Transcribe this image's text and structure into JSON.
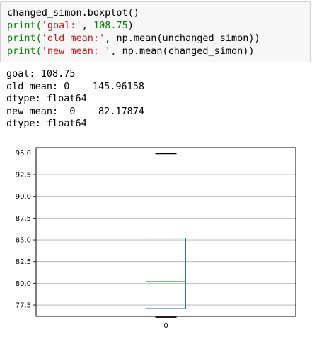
{
  "code_cell": {
    "line1": "changed_simon.boxplot()",
    "line2": {
      "fn": "print(",
      "s1": "'goal:'",
      "sep": ", ",
      "num": "108.75",
      "close": ")"
    },
    "line3": {
      "fn": "print(",
      "s1": "'old mean:'",
      "rest": ", np.mean(unchanged_simon))"
    },
    "line4": {
      "fn": "print(",
      "s1": "'new mean: '",
      "rest": ", np.mean(changed_simon))"
    }
  },
  "output": {
    "lines": [
      "goal: 108.75",
      "old mean: 0    145.96158",
      "dtype: float64",
      "new mean:  0    82.17874",
      "dtype: float64"
    ]
  },
  "chart_data": {
    "type": "box",
    "categories": [
      "0"
    ],
    "ylim": [
      76.2,
      95.6
    ],
    "yticks": [
      77.5,
      80.0,
      82.5,
      85.0,
      87.5,
      90.0,
      92.5,
      95.0
    ],
    "ytick_labels": [
      "77.5",
      "80.0",
      "82.5",
      "85.0",
      "87.5",
      "90.0",
      "92.5",
      "95.0"
    ],
    "xtick_labels": [
      "0"
    ],
    "boxes": [
      {
        "whisker_low": 76.1,
        "q1": 77.1,
        "median": 80.2,
        "q3": 85.2,
        "whisker_high": 94.9
      }
    ],
    "grid": true,
    "colors": {
      "box": "#1f77b4",
      "median": "#2ca02c",
      "whisker": "#1f77b4",
      "cap": "#000000",
      "grid": "#b0b0b0"
    }
  }
}
